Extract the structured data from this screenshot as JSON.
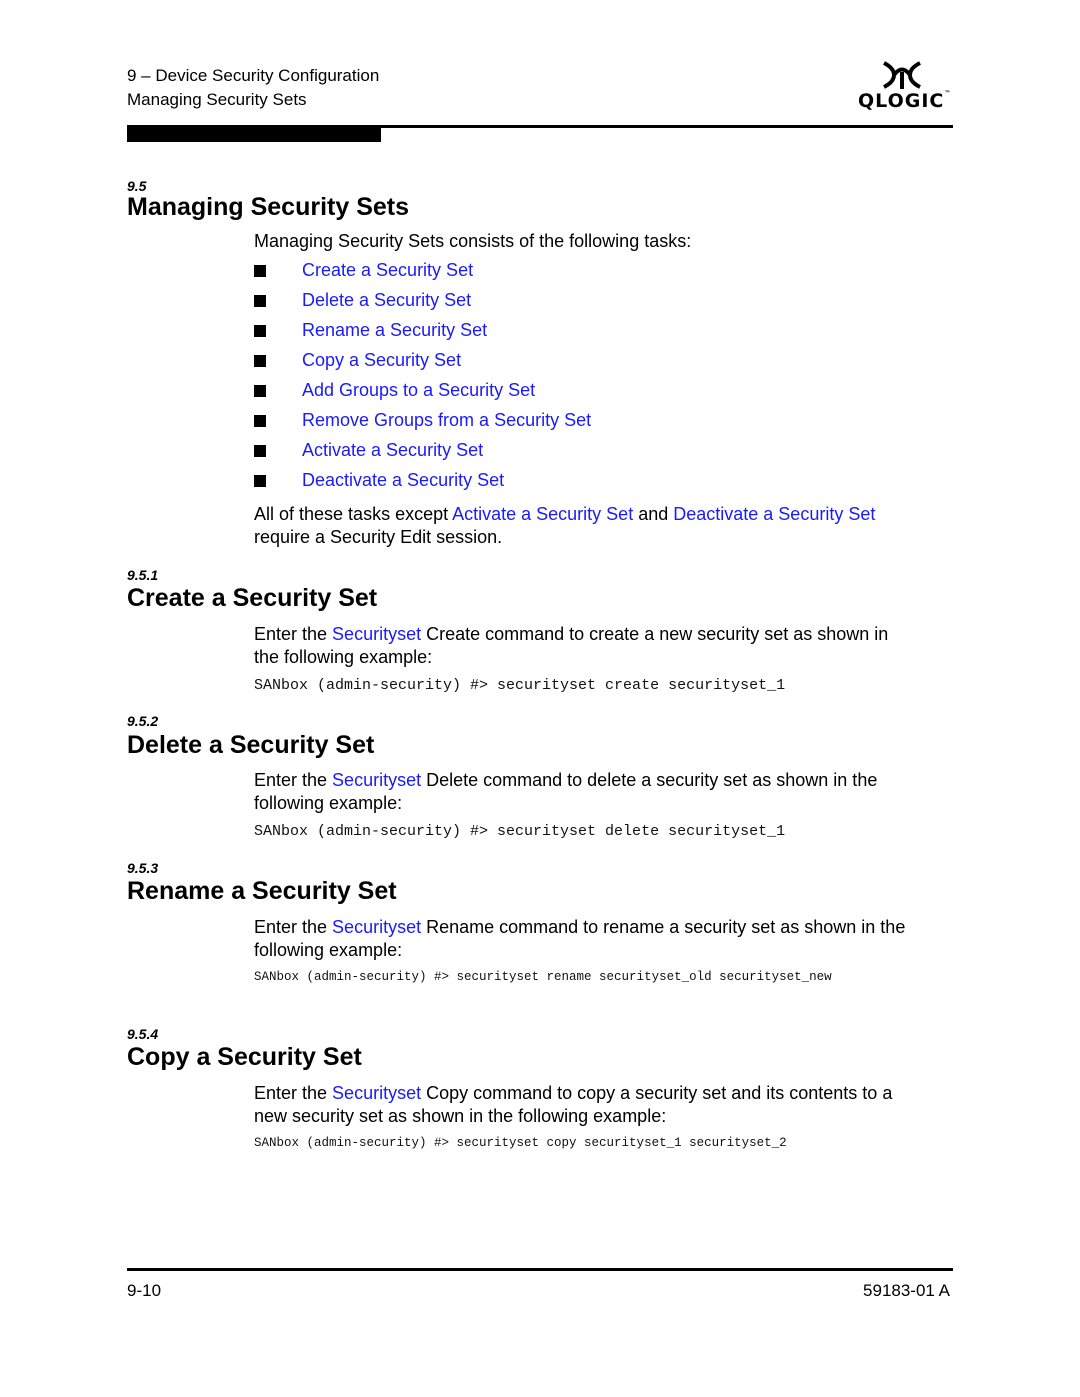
{
  "header": {
    "chapter": "9 – Device Security Configuration",
    "section": "Managing Security Sets",
    "logo_text": "QLOGIC",
    "logo_icon": "qlogic-logo-icon"
  },
  "section_9_5": {
    "number": "9.5",
    "title": "Managing Security Sets",
    "intro": "Managing Security Sets consists of the following tasks:",
    "tasks": [
      "Create a Security Set",
      "Delete a Security Set",
      "Rename a Security Set",
      "Copy a Security Set",
      "Add Groups to a Security Set",
      "Remove Groups from a Security Set",
      "Activate a Security Set",
      "Deactivate a Security Set"
    ],
    "note_part1": "All of these tasks except ",
    "note_link1": "Activate a Security Set",
    "note_part2": " and ",
    "note_link2": "Deactivate a Security Set",
    "note_part3": "require a Security Edit session."
  },
  "section_9_5_1": {
    "number": "9.5.1",
    "title": "Create a Security Set",
    "text_pre": "Enter the ",
    "link": "Securityset",
    "text_post": " Create command to create a new security set as shown in",
    "text_line2": "the following example:",
    "code": "SANbox (admin-security) #> securityset create securityset_1"
  },
  "section_9_5_2": {
    "number": "9.5.2",
    "title": "Delete a Security Set",
    "text_pre": "Enter the ",
    "link": "Securityset",
    "text_post": " Delete command to delete a security set as shown in the",
    "text_line2": "following example:",
    "code": "SANbox (admin-security) #> securityset delete securityset_1"
  },
  "section_9_5_3": {
    "number": "9.5.3",
    "title": "Rename a Security Set",
    "text_pre": "Enter the ",
    "link": "Securityset",
    "text_post": " Rename command to rename a security set as shown in the",
    "text_line2": "following example:",
    "code": "SANbox (admin-security) #> securityset rename securityset_old securityset_new"
  },
  "section_9_5_4": {
    "number": "9.5.4",
    "title": "Copy a Security Set",
    "text_pre": "Enter the ",
    "link": "Securityset",
    "text_post": " Copy command to copy a security set and its contents to a",
    "text_line2": "new security set as shown in the following example:",
    "code": "SANbox (admin-security) #> securityset copy securityset_1 securityset_2"
  },
  "footer": {
    "page_number": "9-10",
    "doc_number": "59183-01 A"
  }
}
